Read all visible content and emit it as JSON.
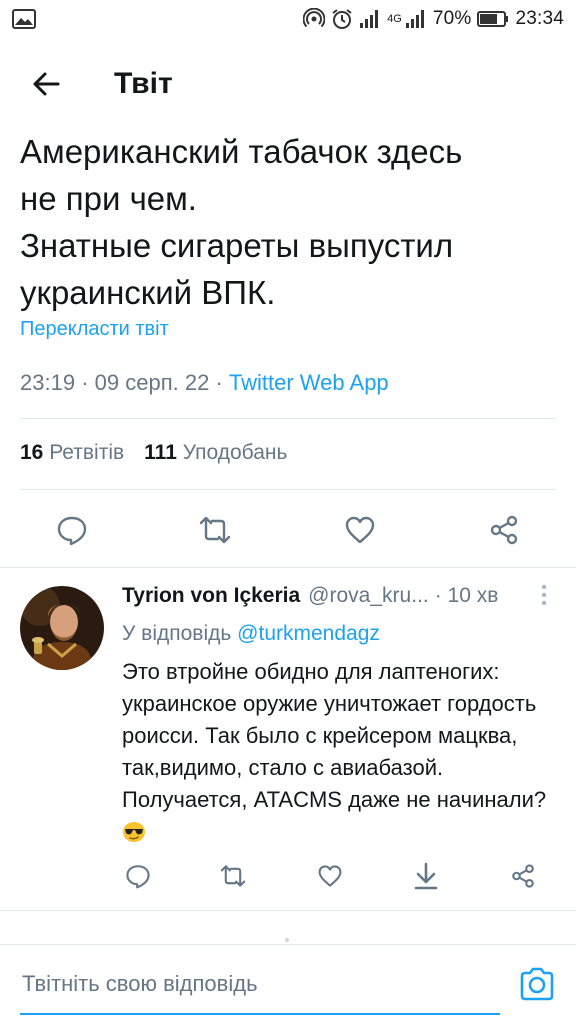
{
  "status_bar": {
    "network_type": "4G",
    "battery_percent": "70%",
    "time": "23:34",
    "icons": [
      "image-icon",
      "hotspot-icon",
      "alarm-icon",
      "signal-icon",
      "battery-icon"
    ]
  },
  "header": {
    "title": "Твіт"
  },
  "tweet": {
    "text": "Американский табачок здесь\nне при чем.\nЗнатные сигареты выпустил\nукраинский ВПК.",
    "translate_label": "Перекласти твіт",
    "time": "23:19",
    "date": "09 серп. 22",
    "app": "Twitter Web App",
    "retweets_count": "16",
    "retweets_label": "Ретвітів",
    "likes_count": "111",
    "likes_label": "Уподобань"
  },
  "reply": {
    "name": "Tyrion von Içkeria",
    "handle": "@rova_kru...",
    "time": "10 хв",
    "reply_to_prefix": "У відповідь",
    "reply_to_mention": "@turkmendagz",
    "text": "Это втройне обидно для лаптеногих: украинское оружие уничтожает гордость роисси. Так было с крейсером мацква, так,видимо, стало с авиабазой. Получается, ATACMS даже не начинали?",
    "emoji": "cool-face-emoji"
  },
  "compose": {
    "placeholder": "Твітніть свою відповідь"
  },
  "colors": {
    "accent": "#1da1f2",
    "text_primary": "#14171a",
    "text_secondary": "#657786",
    "divider": "#e1e8ed"
  }
}
